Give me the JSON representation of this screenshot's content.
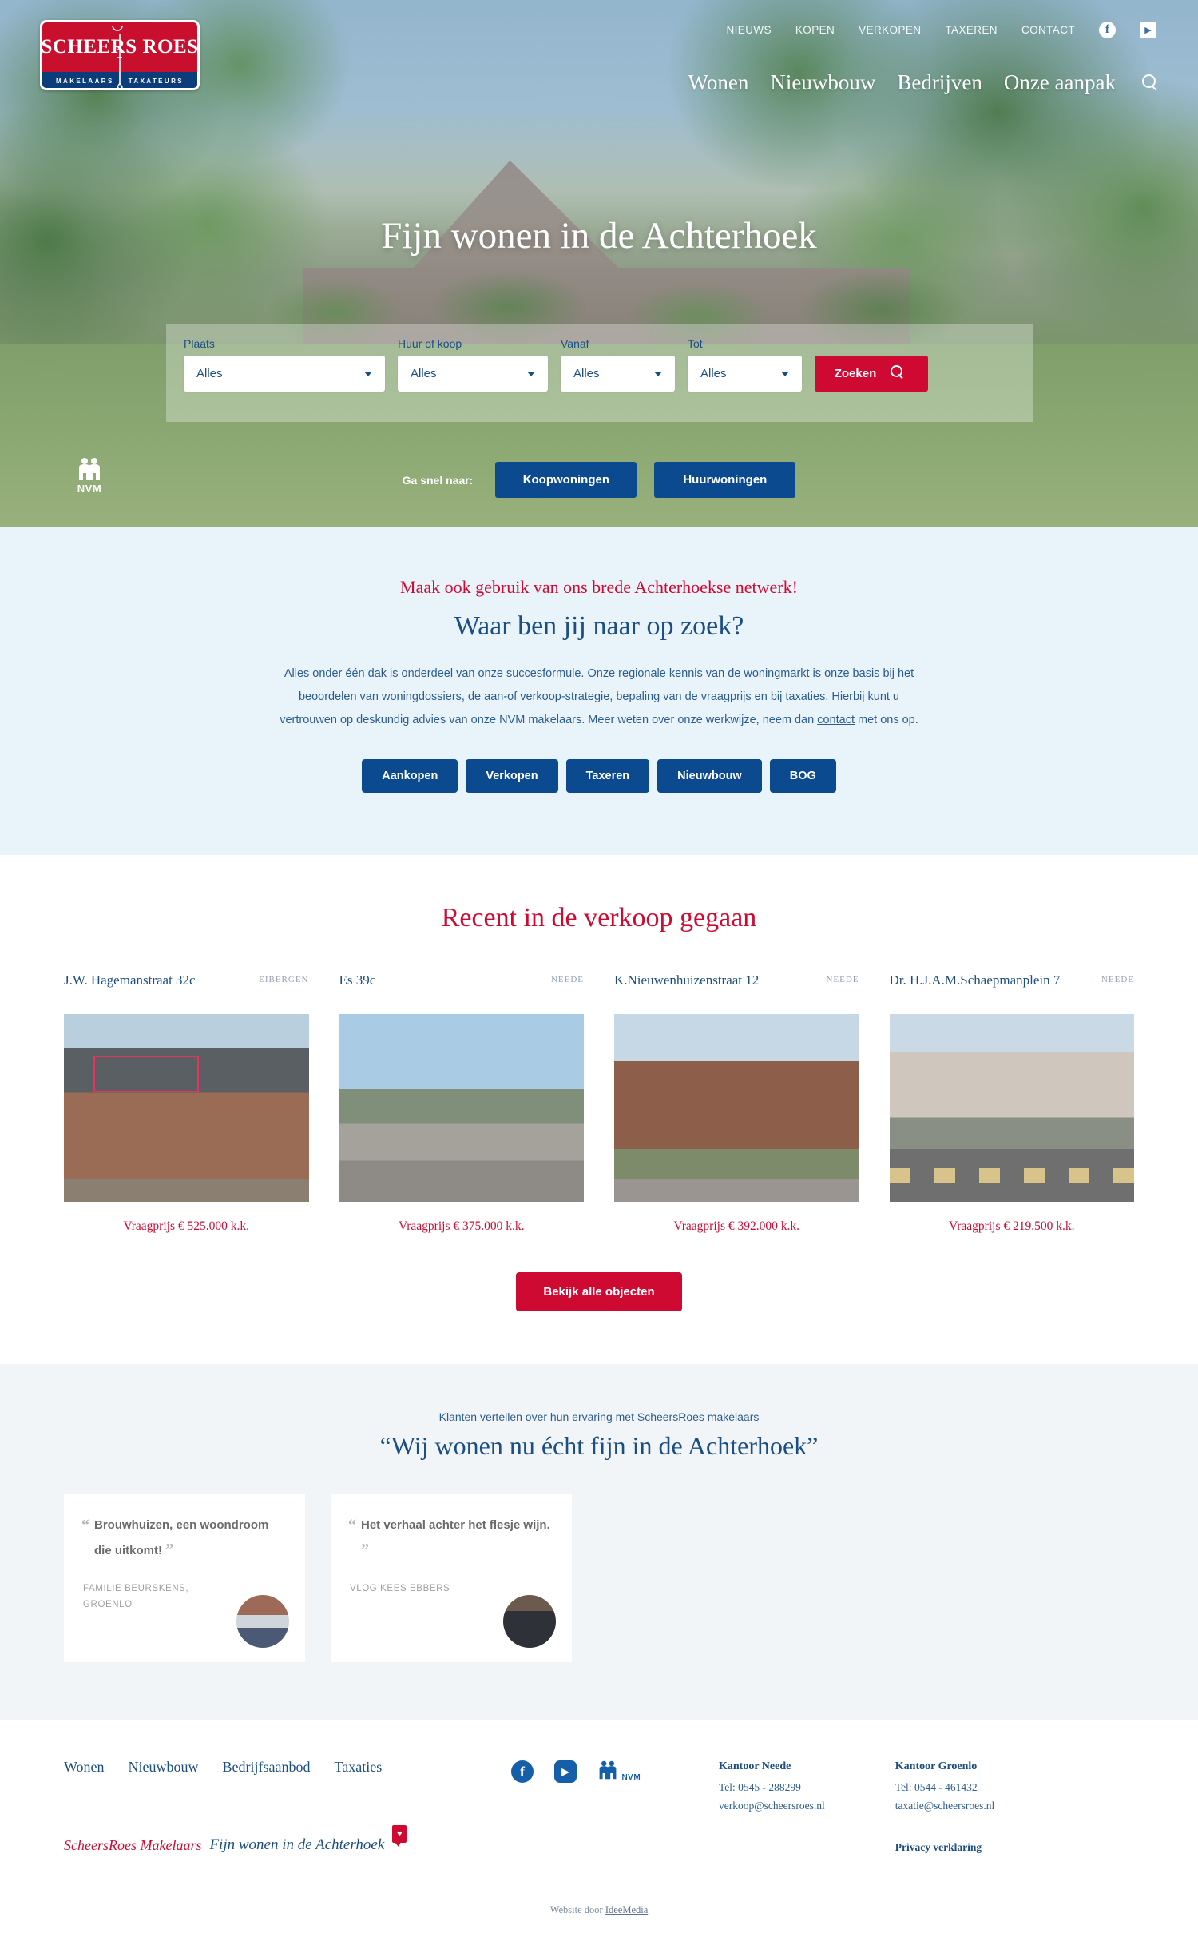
{
  "brand": {
    "logo_word": "SCHEERS ROES",
    "logo_sub_left": "MAKELAARS",
    "logo_sub_right": "TAXATEURS"
  },
  "header": {
    "top_links": [
      "NIEUWS",
      "KOPEN",
      "VERKOPEN",
      "TAXEREN",
      "CONTACT"
    ],
    "social": [
      {
        "name": "facebook-icon",
        "glyph": "f"
      },
      {
        "name": "youtube-icon",
        "glyph": "▶"
      }
    ],
    "main_links": [
      "Wonen",
      "Nieuwbouw",
      "Bedrijven",
      "Onze aanpak"
    ],
    "search_icon": "search-icon"
  },
  "hero": {
    "title": "Fijn wonen in de Achterhoek",
    "search": {
      "fields": [
        {
          "label": "Plaats",
          "value": "Alles"
        },
        {
          "label": "Huur of koop",
          "value": "Alles"
        },
        {
          "label": "Vanaf",
          "value": "Alles"
        },
        {
          "label": "Tot",
          "value": "Alles"
        }
      ],
      "button": "Zoeken"
    },
    "quick": {
      "label": "Ga snel naar:",
      "buttons": [
        "Koopwoningen",
        "Huurwoningen"
      ]
    },
    "nvm_label": "NVM"
  },
  "intro": {
    "kicker": "Maak ook gebruik van ons brede Achterhoekse netwerk!",
    "heading": "Waar ben jij naar op zoek?",
    "body_part1": "Alles onder één dak is onderdeel van onze succesformule. Onze regionale kennis van de woningmarkt is onze basis bij het beoordelen van woningdossiers, de aan-of verkoop-strategie, bepaling van de vraagprijs en bij taxaties. Hierbij kunt u vertrouwen op deskundig advies van onze NVM makelaars. Meer weten over onze werkwijze, neem dan ",
    "body_link": "contact",
    "body_part2": " met ons op.",
    "chips": [
      "Aankopen",
      "Verkopen",
      "Taxeren",
      "Nieuwbouw",
      "BOG"
    ]
  },
  "listings": {
    "heading": "Recent in de verkoop gegaan",
    "items": [
      {
        "address": "J.W. Hagemanstraat 32c",
        "city": "EIBERGEN",
        "price": "Vraagprijs € 525.000 k.k."
      },
      {
        "address": "Es 39c",
        "city": "NEEDE",
        "price": "Vraagprijs € 375.000 k.k."
      },
      {
        "address": "K.Nieuwenhuizenstraat 12",
        "city": "NEEDE",
        "price": "Vraagprijs € 392.000 k.k."
      },
      {
        "address": "Dr. H.J.A.M.Schaepmanplein 7",
        "city": "NEEDE",
        "price": "Vraagprijs € 219.500 k.k."
      }
    ],
    "cta": "Bekijk alle objecten"
  },
  "testimonials": {
    "subtitle": "Klanten vertellen over hun ervaring met ScheersRoes makelaars",
    "heading": "“Wij wonen nu écht fijn in de Achterhoek”",
    "items": [
      {
        "quote": "Brouwhuizen, een woondroom die uitkomt!",
        "meta": "FAMILIE BEURSKENS, GROENLO"
      },
      {
        "quote": "Het verhaal achter het flesje wijn.",
        "meta": "VLOG KEES EBBERS"
      }
    ]
  },
  "footer": {
    "nav": [
      "Wonen",
      "Nieuwbouw",
      "Bedrijfsaanbod",
      "Taxaties"
    ],
    "social": [
      {
        "name": "facebook-icon",
        "glyph": "f"
      },
      {
        "name": "youtube-icon",
        "glyph": "▶"
      }
    ],
    "nvm_label": "NVM",
    "tagline_brand": "ScheersRoes Makelaars",
    "tagline_slogan": "Fijn wonen in de Achterhoek",
    "offices": [
      {
        "title": "Kantoor Neede",
        "phone": "Tel: 0545 - 288299",
        "email": "verkoop@scheersroes.nl"
      },
      {
        "title": "Kantoor Groenlo",
        "phone": "Tel: 0544 - 461432",
        "email": "taxatie@scheersroes.nl"
      }
    ],
    "privacy": "Privacy verklaring",
    "credit_prefix": "Website door ",
    "credit_link": "IdeeMedia"
  },
  "colors": {
    "brand_red": "#cf0a32",
    "brand_blue": "#0b4a8f",
    "deep_blue": "#1b4e82",
    "section_blue": "#e9f3fa",
    "section_grey": "#f2f5f8"
  }
}
